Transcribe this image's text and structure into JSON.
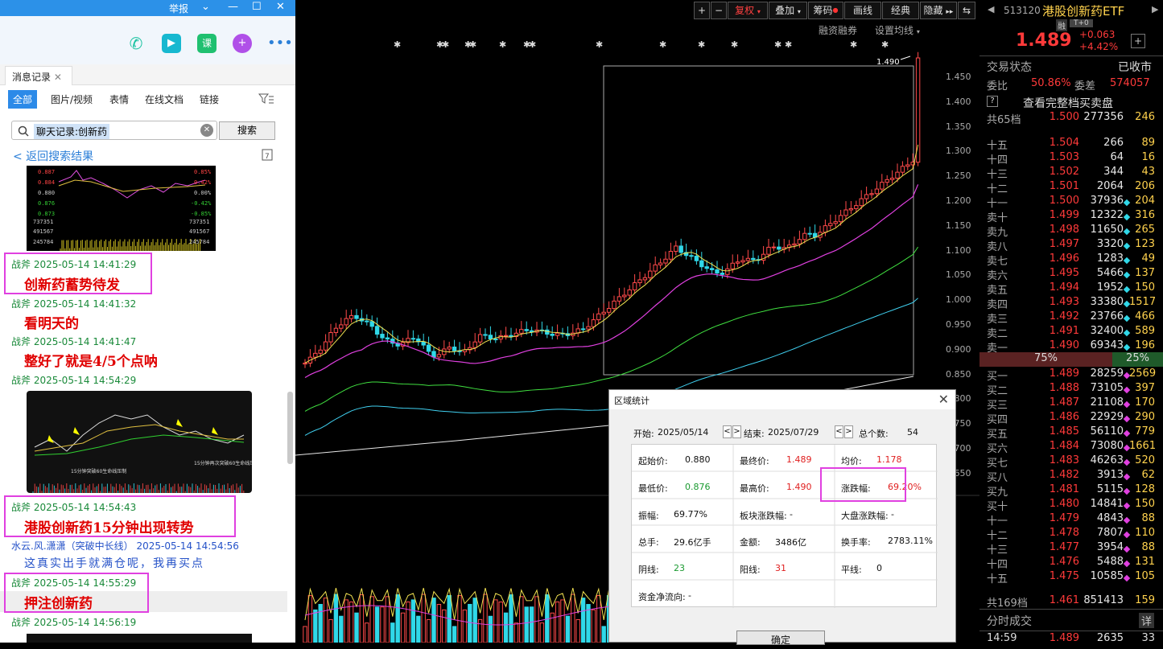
{
  "window": {
    "report": "举报"
  },
  "left": {
    "tab": "消息记录",
    "filters": [
      "全部",
      "图片/视频",
      "表情",
      "在线文档",
      "链接"
    ],
    "search": {
      "value": "聊天记录:创新药",
      "button": "搜索"
    },
    "back": "< 返回搜索结果",
    "thumb1": {
      "y_labels": [
        "0.887",
        "0.884",
        "0.880",
        "0.876",
        "0.873",
        "737351",
        "491567",
        "245784"
      ],
      "pct_labels": [
        "0.85%",
        "0.42%",
        "0.00%",
        "-0.42%",
        "-0.85%",
        "737351",
        "491567",
        "245784"
      ]
    },
    "thumb2": {
      "note1": "15分钟突破60生命线压制",
      "note2": "15分钟再次突破60生命线压制"
    },
    "messages": [
      {
        "sender": "战斧 2025-05-14 14:41:29",
        "text": "创新药蓄势待发"
      },
      {
        "sender": "战斧 2025-05-14 14:41:32",
        "text": "看明天的"
      },
      {
        "sender": "战斧 2025-05-14 14:41:47",
        "text": "整好了就是4/5个点呐"
      },
      {
        "sender": "战斧 2025-05-14 14:54:29",
        "text": ""
      },
      {
        "sender": "战斧 2025-05-14 14:54:43",
        "text": "港股创新药15分钟出现转势"
      },
      {
        "sender": "水云.风.潇潇（突破中长线） 2025-05-14 14:54:56",
        "text": "这真实出手就满仓呢，我再买点"
      },
      {
        "sender": "战斧 2025-05-14 14:55:29",
        "text": "押注创新药"
      },
      {
        "sender": "战斧 2025-05-14 14:56:19",
        "text": ""
      }
    ]
  },
  "toolbar": {
    "buttons": [
      "+",
      "−",
      "复权",
      "叠加",
      "筹码",
      "画线",
      "经典",
      "隐藏"
    ],
    "sub": [
      "融资融券",
      "设置均线"
    ]
  },
  "chart": {
    "price_tag": "1.490",
    "y_ticks": [
      "1.450",
      "1.400",
      "1.350",
      "1.300",
      "1.250",
      "1.200",
      "1.150",
      "1.100",
      "1.050",
      "1.000",
      "0.950",
      "0.900",
      "0.850",
      "0.800",
      "0.750",
      "0.700",
      "0.650"
    ]
  },
  "dialog": {
    "title": "区域统计",
    "start_label": "开始:",
    "start": "2025/05/14",
    "end_label": "结束:",
    "end": "2025/07/29",
    "count_label": "总个数:",
    "count": "54",
    "cells": [
      [
        "起始价:",
        "0.880",
        "最终价:",
        "1.489",
        "均价:",
        "1.178"
      ],
      [
        "最低价:",
        "0.876",
        "最高价:",
        "1.490",
        "涨跌幅:",
        "69.20%"
      ],
      [
        "振幅:",
        "69.77%",
        "板块涨跌幅:",
        "-",
        "大盘涨跌幅:",
        "-"
      ],
      [
        "总手:",
        "29.6亿手",
        "金额:",
        "3486亿",
        "换手率:",
        "2783.11%"
      ],
      [
        "阴线:",
        "23",
        "阳线:",
        "31",
        "平线:",
        "0"
      ],
      [
        "资金净流向:",
        "-",
        "",
        "",
        "",
        ""
      ]
    ],
    "ok": "确定"
  },
  "quote": {
    "code": "513120",
    "name": "港股创新药ETF",
    "tag1": "融",
    "tag2": "T+0",
    "price": "1.489",
    "change": "+0.063",
    "change_pct": "+4.42%",
    "status_label": "交易状态",
    "status": "已收市",
    "weibi_label": "委比",
    "weibi": "50.86%",
    "weicha_label": "委差",
    "weicha": "574057",
    "full_book": "查看完整档买卖盘",
    "ask_total": {
      "label": "共65档",
      "price": "1.500",
      "vol": "277356",
      "cnt": "246"
    },
    "asks": [
      [
        "十五",
        "1.504",
        "266",
        "89"
      ],
      [
        "十四",
        "1.503",
        "64",
        "16"
      ],
      [
        "十三",
        "1.502",
        "344",
        "43"
      ],
      [
        "十二",
        "1.501",
        "2064",
        "206"
      ],
      [
        "十一",
        "1.500",
        "37936",
        "204"
      ],
      [
        "卖十",
        "1.499",
        "12322",
        "316"
      ],
      [
        "卖九",
        "1.498",
        "11650",
        "265"
      ],
      [
        "卖八",
        "1.497",
        "3320",
        "123"
      ],
      [
        "卖七",
        "1.496",
        "1283",
        "49"
      ],
      [
        "卖六",
        "1.495",
        "5466",
        "137"
      ],
      [
        "卖五",
        "1.494",
        "1952",
        "150"
      ],
      [
        "卖四",
        "1.493",
        "33380",
        "1517"
      ],
      [
        "卖三",
        "1.492",
        "23766",
        "466"
      ],
      [
        "卖二",
        "1.491",
        "32400",
        "589"
      ],
      [
        "卖一",
        "1.490",
        "69343",
        "196"
      ]
    ],
    "ratio": {
      "left": "75%",
      "right": "25%"
    },
    "bids": [
      [
        "买一",
        "1.489",
        "28259",
        "2569"
      ],
      [
        "买二",
        "1.488",
        "73105",
        "397"
      ],
      [
        "买三",
        "1.487",
        "21108",
        "170"
      ],
      [
        "买四",
        "1.486",
        "22929",
        "290"
      ],
      [
        "买五",
        "1.485",
        "56110",
        "779"
      ],
      [
        "买六",
        "1.484",
        "73080",
        "1661"
      ],
      [
        "买七",
        "1.483",
        "46263",
        "520"
      ],
      [
        "买八",
        "1.482",
        "3913",
        "62"
      ],
      [
        "买九",
        "1.481",
        "5115",
        "128"
      ],
      [
        "买十",
        "1.480",
        "14841",
        "150"
      ],
      [
        "十一",
        "1.479",
        "4843",
        "88"
      ],
      [
        "十二",
        "1.478",
        "7807",
        "110"
      ],
      [
        "十三",
        "1.477",
        "3954",
        "88"
      ],
      [
        "十四",
        "1.476",
        "5488",
        "131"
      ],
      [
        "十五",
        "1.475",
        "10585",
        "105"
      ]
    ],
    "bid_total": {
      "label": "共169档",
      "price": "1.461",
      "vol": "851413",
      "cnt": "159"
    },
    "ticks_label": "分时成交",
    "ticks_btn": "详",
    "last_tick": {
      "time": "14:59",
      "price": "1.489",
      "vol": "2635",
      "cnt": "33"
    }
  }
}
